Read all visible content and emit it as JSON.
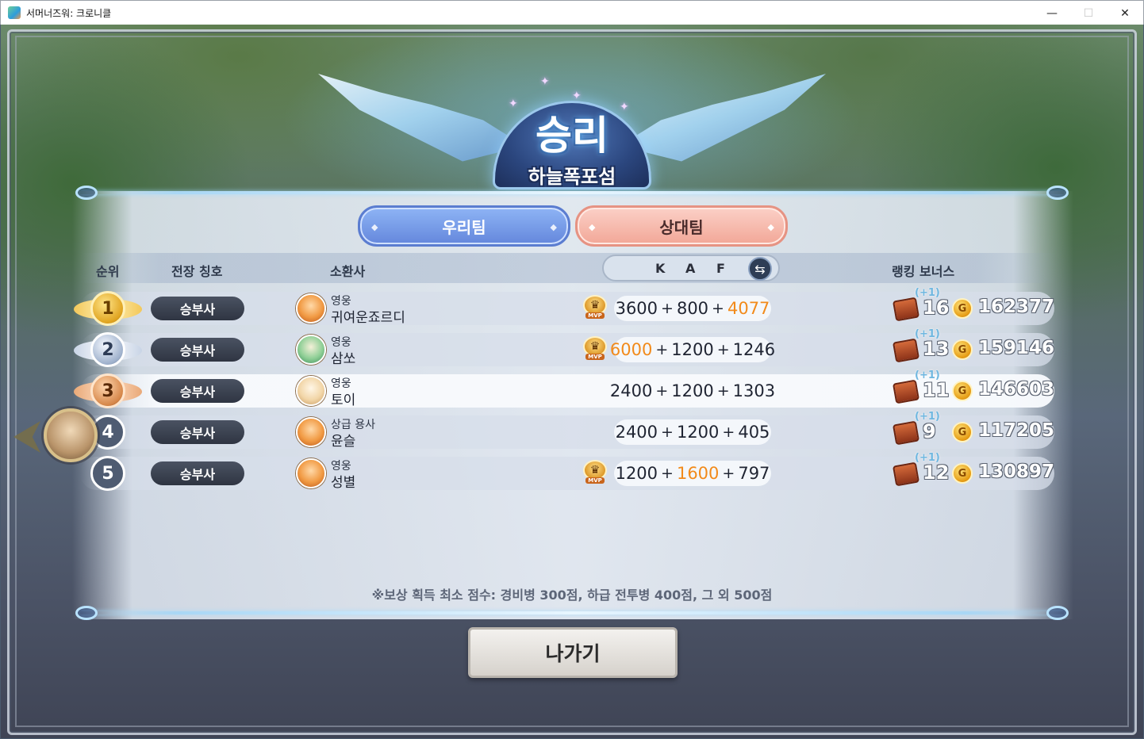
{
  "window": {
    "title": "서머너즈워: 크로니클",
    "min_glyph": "—",
    "max_glyph": "☐",
    "close_glyph": "✕"
  },
  "result": {
    "title": "승리",
    "map": "하늘폭포섬"
  },
  "tabs": {
    "ours": "우리팀",
    "theirs": "상대팀"
  },
  "headers": {
    "rank": "순위",
    "title": "전장 칭호",
    "summoner": "소환사",
    "k": "K",
    "a": "A",
    "f": "F",
    "bonus": "랭킹 보너스"
  },
  "icons": {
    "swap": "swap-icon",
    "chest": "chest-icon",
    "coin": "gold-coin-icon",
    "mvp": "mvp-icon"
  },
  "colors": {
    "highlight_score": "#f28a1a",
    "our_tab": "#6487dc",
    "their_tab": "#f2a797"
  },
  "players": [
    {
      "rank": "1",
      "title": "승부사",
      "grade": "영웅",
      "name": "귀여운죠르디",
      "k": "3600",
      "a": "800",
      "f": "4077",
      "hi": "f",
      "mvp": true,
      "bonus_plus": "(+1)",
      "bonus": "16",
      "gold": "162377"
    },
    {
      "rank": "2",
      "title": "승부사",
      "grade": "영웅",
      "name": "삼쏘",
      "k": "6000",
      "a": "1200",
      "f": "1246",
      "hi": "k",
      "mvp": true,
      "bonus_plus": "(+1)",
      "bonus": "13",
      "gold": "159146"
    },
    {
      "rank": "3",
      "title": "승부사",
      "grade": "영웅",
      "name": "토이",
      "k": "2400",
      "a": "1200",
      "f": "1303",
      "hi": "",
      "mvp": false,
      "bonus_plus": "(+1)",
      "bonus": "11",
      "gold": "146603"
    },
    {
      "rank": "4",
      "title": "승부사",
      "grade": "상급 용사",
      "name": "윤슬",
      "k": "2400",
      "a": "1200",
      "f": "405",
      "hi": "",
      "mvp": false,
      "bonus_plus": "(+1)",
      "bonus": "9",
      "gold": "117205"
    },
    {
      "rank": "5",
      "title": "승부사",
      "grade": "영웅",
      "name": "성별",
      "k": "1200",
      "a": "1600",
      "f": "797",
      "hi": "a",
      "mvp": true,
      "bonus_plus": "(+1)",
      "bonus": "12",
      "gold": "130897"
    }
  ],
  "plus_sign": "+",
  "footnote": "※보상 획득 최소 점수: 경비병 300점, 하급 전투병 400점, 그 외 500점",
  "exit_button": "나가기"
}
